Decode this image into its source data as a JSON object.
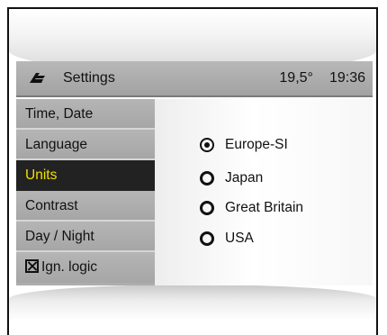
{
  "header": {
    "title": "Settings",
    "temperature": "19,5°",
    "time": "19:36",
    "logo_icon": "brand-logo-icon"
  },
  "sidebar": {
    "items": [
      {
        "label": "Time, Date",
        "active": false
      },
      {
        "label": "Language",
        "active": false
      },
      {
        "label": "Units",
        "active": true
      },
      {
        "label": "Contrast",
        "active": false
      },
      {
        "label": "Day / Night",
        "active": false
      },
      {
        "label": "Ign. logic",
        "active": false,
        "checkbox": "checked"
      }
    ]
  },
  "units": {
    "options": [
      {
        "label": "Europe-SI",
        "selected": true
      },
      {
        "label": "Japan",
        "selected": false
      },
      {
        "label": "Great Britain",
        "selected": false
      },
      {
        "label": "USA",
        "selected": false
      }
    ]
  },
  "colors": {
    "active_item_bg": "#222222",
    "active_item_text": "#f0e000",
    "menu_bg": "#adadad"
  }
}
